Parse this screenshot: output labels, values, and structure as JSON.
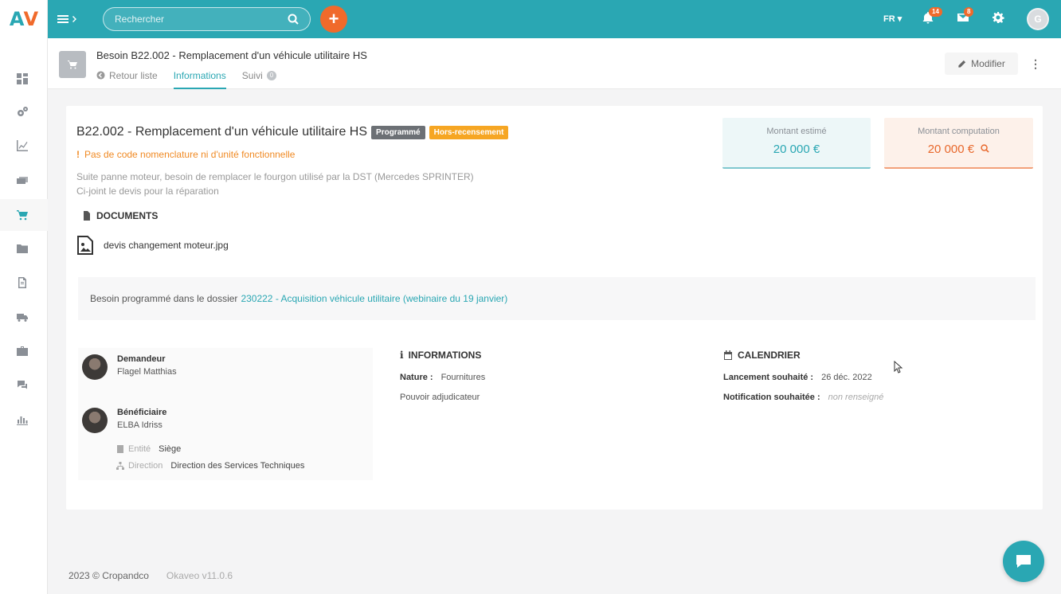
{
  "app": {
    "logo_a": "A",
    "logo_v": "V"
  },
  "topbar": {
    "search_placeholder": "Rechercher",
    "add_label": "+",
    "language": "FR",
    "notifications_count": "14",
    "messages_count": "8",
    "user_initial": "G",
    "accent_color": "#2aa7b3",
    "secondary_color": "#f06a2b"
  },
  "sidebar": {
    "items": [
      {
        "icon": "dashboard-icon"
      },
      {
        "icon": "settings-gears-icon"
      },
      {
        "icon": "chart-line-icon"
      },
      {
        "icon": "money-icon"
      },
      {
        "icon": "cart-icon",
        "active": true
      },
      {
        "icon": "folder-icon"
      },
      {
        "icon": "document-icon"
      },
      {
        "icon": "truck-icon"
      },
      {
        "icon": "briefcase-icon"
      },
      {
        "icon": "comments-icon"
      },
      {
        "icon": "bar-chart-icon"
      }
    ]
  },
  "header": {
    "title": "Besoin B22.002 - Remplacement d'un véhicule utilitaire HS",
    "tabs": [
      {
        "label": "Retour liste"
      },
      {
        "label": "Informations",
        "active": true
      },
      {
        "label": "Suivi",
        "count": "0"
      }
    ],
    "modify_label": "Modifier",
    "more_label": "⋮"
  },
  "need": {
    "title": "B22.002 - Remplacement d'un véhicule utilitaire HS",
    "tag_programmed": "Programmé",
    "tag_fonctionnement": "Hors-recensement",
    "warning_mark": "!",
    "warning": "Pas de code nomenclature ni d'unité fonctionnelle",
    "description_line1": "Suite panne moteur, besoin de remplacer le fourgon utilisé par la DST (Mercedes SPRINTER)",
    "description_line2": "Ci-joint le devis pour la réparation"
  },
  "amounts": {
    "estimated_label": "Montant estimé",
    "estimated_value": "20 000 €",
    "computation_label": "Montant computation",
    "computation_value": "20 000 €"
  },
  "documents": {
    "heading": "DOCUMENTS",
    "files": [
      {
        "name": "devis changement moteur.jpg"
      }
    ]
  },
  "dossier": {
    "prefix": "Besoin programmé dans le dossier",
    "link": "230222 - Acquisition véhicule utilitaire (webinaire du 19 janvier)"
  },
  "people": {
    "requester_role": "Demandeur",
    "requester_name": "Flagel Matthias",
    "beneficiary_role": "Bénéficiaire",
    "beneficiary_name": "ELBA Idriss",
    "entity_label": "Entité",
    "entity_value": "Siège",
    "direction_label": "Direction",
    "direction_value": "Direction des Services Techniques"
  },
  "informations": {
    "heading": "INFORMATIONS",
    "nature_label": "Nature :",
    "nature_value": "Fournitures",
    "power_label": "Pouvoir adjudicateur"
  },
  "calendar": {
    "heading": "CALENDRIER",
    "launch_label": "Lancement souhaité :",
    "launch_value": "26 déc. 2022",
    "notification_label": "Notification souhaitée :",
    "notification_value": "non renseigné"
  },
  "footer": {
    "copyright": "2023 © Cropandco",
    "version": "Okaveo v11.0.6"
  }
}
